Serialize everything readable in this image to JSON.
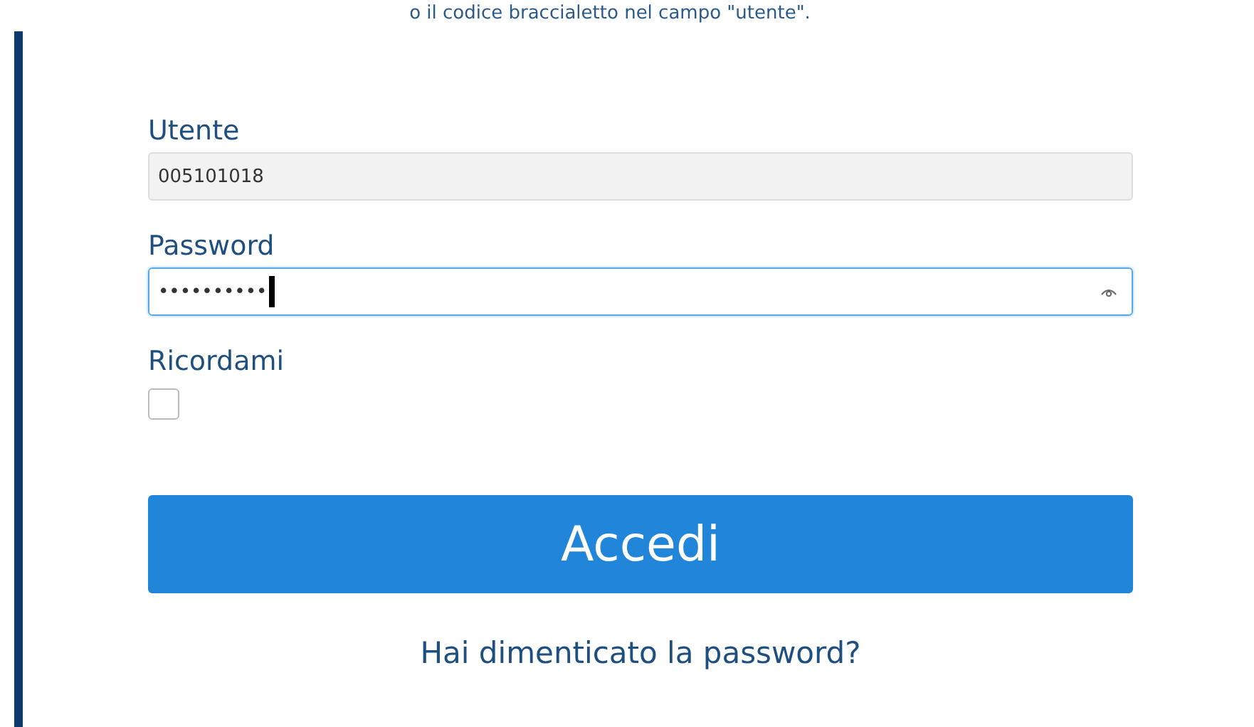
{
  "instruction": "o il codice braccialetto nel campo \"utente\".",
  "fields": [
    {
      "label": "Utente",
      "value": "005101018",
      "kind": "text",
      "readonly": true,
      "focused": false
    },
    {
      "label": "Password",
      "value": "••••••••••",
      "kind": "password",
      "readonly": false,
      "focused": true
    }
  ],
  "remember": {
    "label": "Ricordami",
    "checked": false
  },
  "submit": "Accedi",
  "forgot_link": "Hai dimenticato la password?"
}
